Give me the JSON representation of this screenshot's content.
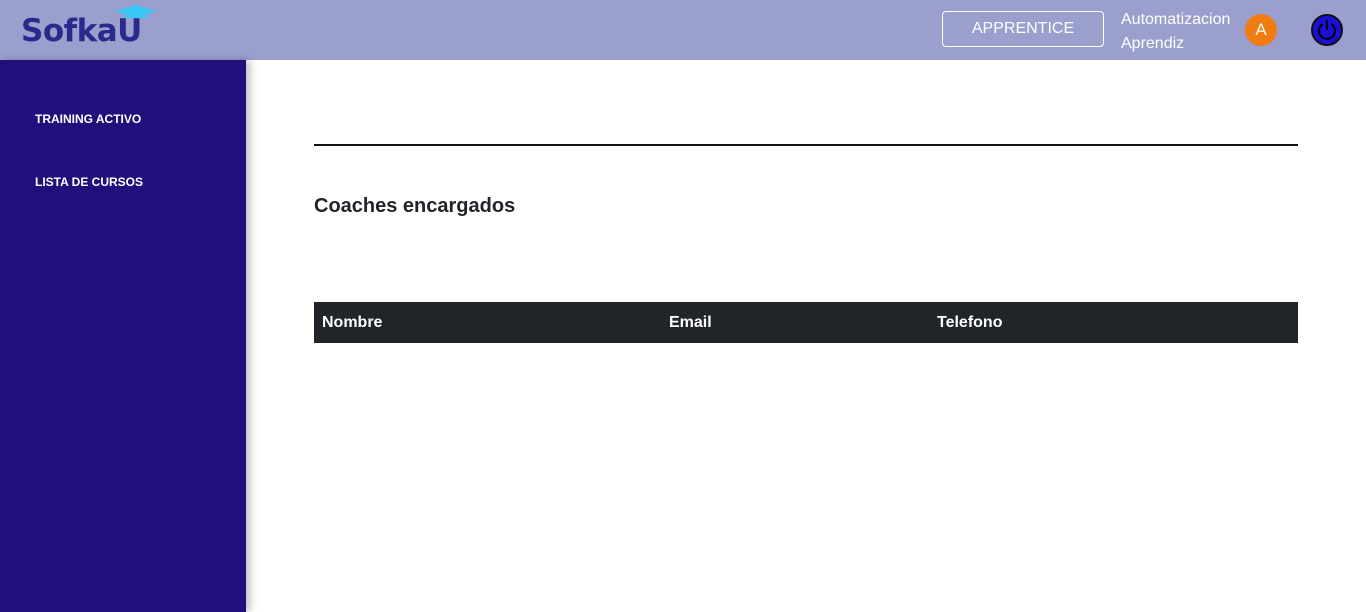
{
  "header": {
    "logo_text": "SofkaU",
    "role_button": "APPRENTICE",
    "user_name_line1": "Automatizacion",
    "user_name_line2": "Aprendiz",
    "avatar_initial": "A",
    "colors": {
      "bar": "#9b9fcd",
      "avatar": "#f07c12",
      "power_icon": "#1a0fd6"
    }
  },
  "sidebar": {
    "items": [
      {
        "label": "TRAINING ACTIVO"
      },
      {
        "label": "LISTA DE CURSOS"
      }
    ],
    "color": "#20107c"
  },
  "main": {
    "section_title": "Coaches encargados",
    "table": {
      "columns": [
        "Nombre",
        "Email",
        "Telefono"
      ],
      "rows": []
    }
  }
}
